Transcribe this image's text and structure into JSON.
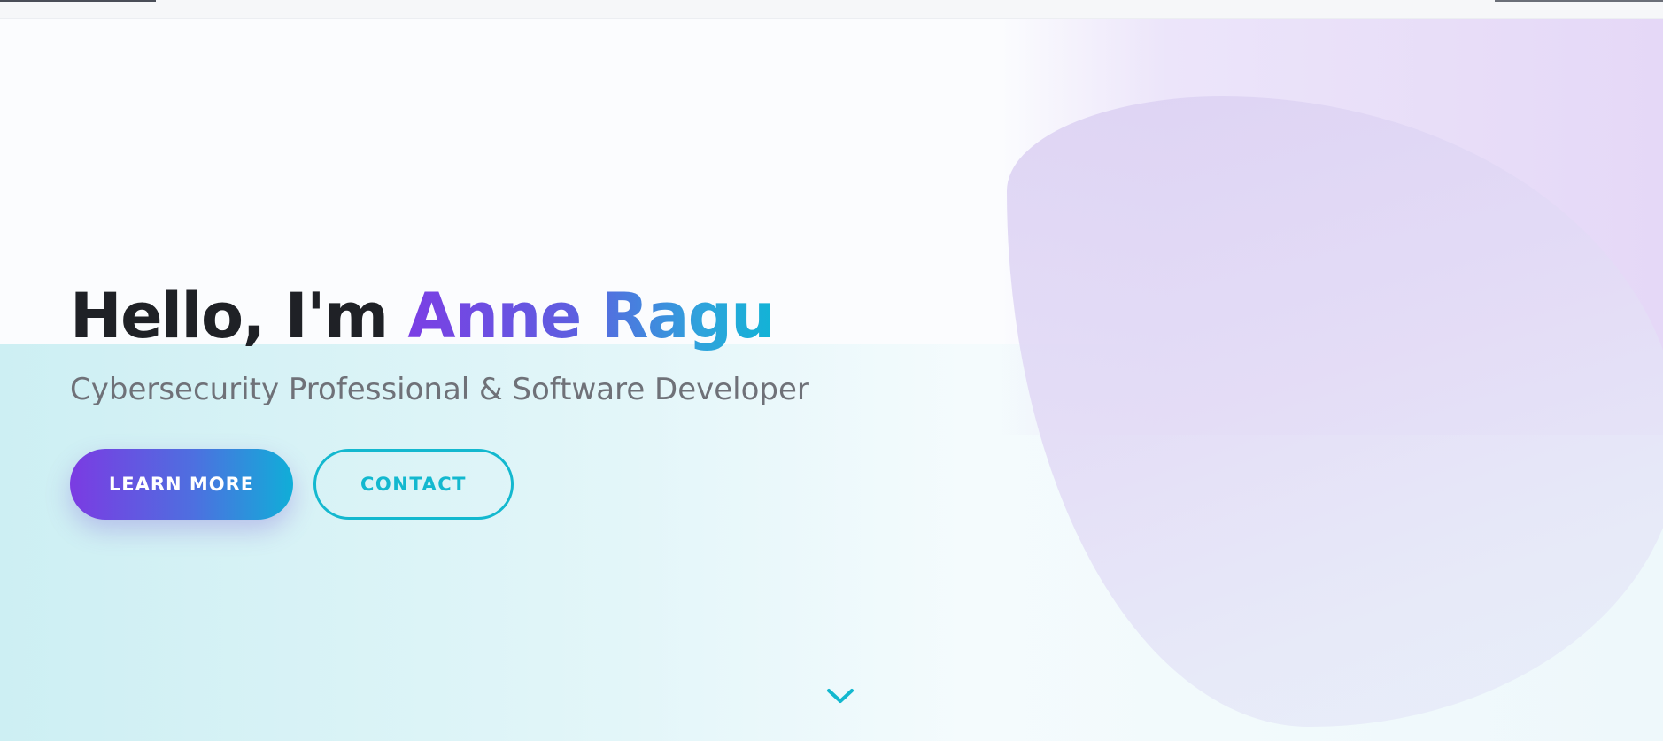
{
  "hero": {
    "greeting": "Hello, I'm ",
    "name": "Anne Ragu",
    "subtitle": "Cybersecurity Professional & Software Developer"
  },
  "actions": {
    "learn_more_label": "LEARN MORE",
    "contact_label": "CONTACT"
  },
  "icons": {
    "scroll_down": "chevron-down-icon"
  },
  "colors": {
    "gradient_start": "#7b3be2",
    "gradient_end": "#10aed8",
    "accent_cyan": "#13b8cf",
    "heading_text": "#1f2126",
    "subtitle_text": "#6f7178"
  }
}
